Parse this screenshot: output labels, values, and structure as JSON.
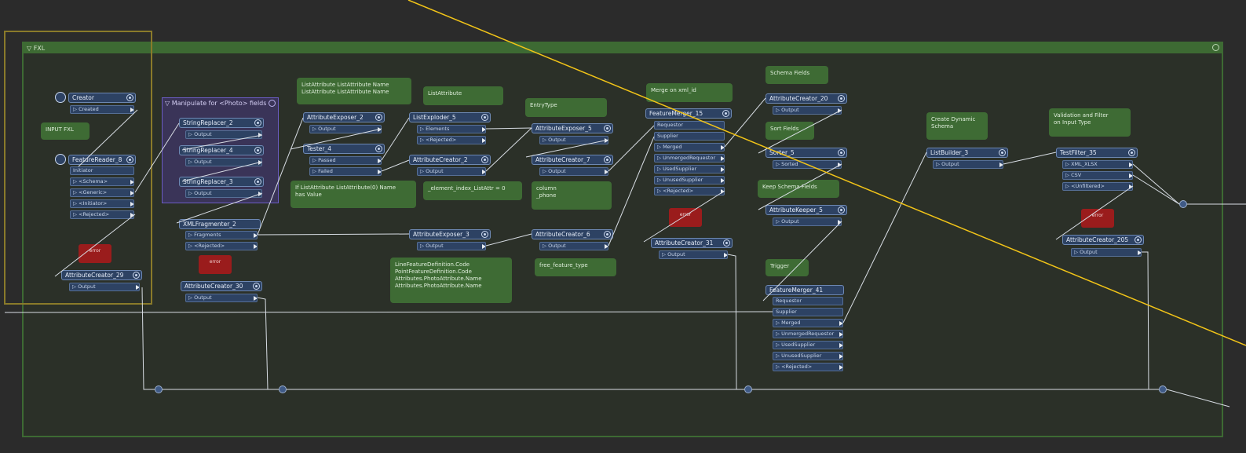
{
  "bookmarks": {
    "main": {
      "title": "▽ FXL"
    },
    "manipulate": {
      "title": "▽ Manipulate for <Photo> fields"
    }
  },
  "annotations": {
    "input_fxl": "INPUT FXL",
    "list_attributes": "ListAttribute ListAttribute Name\nListAttribute ListAttribute Name",
    "list_attr": "ListAttribute",
    "entry_type": "EntryType",
    "merge_on_xml_id": "Merge on xml_id",
    "schema_fields": "Schema Fields",
    "sort_fields": "Sort Fields",
    "keep_schema_fields": "Keep Schema Fields",
    "create_dynamic_schema": "Create Dynamic\nSchema",
    "validation_filter": "Validation and Filter\non Input Type",
    "if_list_attribute": "If ListAttribute ListAttribute(0) Name\nhas Value",
    "element_index": "_element_index_ListAttr = 0",
    "column_phone": "column\n_phone",
    "line_feature": "LineFeatureDefinition.Code\nPointFeatureDefinition.Code\nAttributes.PhotoAttribute.Name\nAttributes.PhotoAttribute.Name",
    "free_feature_type": "free_feature_type",
    "trigger": "Trigger"
  },
  "transformers": {
    "creator": {
      "name": "Creator",
      "ports": [
        "▷ Created"
      ]
    },
    "featurereader_8": {
      "name": "FeatureReader_8",
      "ports": [
        "Initiator",
        "▷ <Schema>",
        "▷ <Generic>",
        "▷ <Initiator>",
        "▷ <Rejected>"
      ]
    },
    "attributecreator_29": {
      "name": "AttributeCreator_29",
      "ports": [
        "▷ Output"
      ]
    },
    "stringreplacer_2": {
      "name": "StringReplacer_2",
      "ports": [
        "▷ Output"
      ]
    },
    "stringreplacer_4": {
      "name": "StringReplacer_4",
      "ports": [
        "▷ Output"
      ]
    },
    "stringreplacer_3": {
      "name": "StringReplacer_3",
      "ports": [
        "▷ Output"
      ]
    },
    "xmlfragmenter_2": {
      "name": "XMLFragmenter_2",
      "ports": [
        "▷ Fragments",
        "▷ <Rejected>"
      ]
    },
    "attributecreator_30": {
      "name": "AttributeCreator_30",
      "ports": [
        "▷ Output"
      ]
    },
    "attributeexposer_2": {
      "name": "AttributeExposer_2",
      "ports": [
        "▷ Output"
      ]
    },
    "tester_4": {
      "name": "Tester_4",
      "ports": [
        "▷ Passed",
        "▷ Failed"
      ]
    },
    "listexploder_5": {
      "name": "ListExploder_5",
      "ports": [
        "▷ Elements",
        "▷ <Rejected>"
      ]
    },
    "attributecreator_2": {
      "name": "AttributeCreator_2",
      "ports": [
        "▷ Output"
      ]
    },
    "attributeexposer_3": {
      "name": "AttributeExposer_3",
      "ports": [
        "▷ Output"
      ]
    },
    "attributeexposer_5": {
      "name": "AttributeExposer_5",
      "ports": [
        "▷ Output"
      ]
    },
    "attributecreator_7": {
      "name": "AttributeCreator_7",
      "ports": [
        "▷ Output"
      ]
    },
    "attributecreator_6": {
      "name": "AttributeCreator_6",
      "ports": [
        "▷ Output"
      ]
    },
    "featuremerger_15": {
      "name": "FeatureMerger_15",
      "ports": [
        "Requestor",
        "Supplier",
        "▷ Merged",
        "▷ UnmergedRequestor",
        "▷ UsedSupplier",
        "▷ UnusedSupplier",
        "▷ <Rejected>"
      ]
    },
    "attributecreator_31": {
      "name": "AttributeCreator_31",
      "ports": [
        "▷ Output"
      ]
    },
    "attributecreator_20": {
      "name": "AttributeCreator_20",
      "ports": [
        "▷ Output"
      ]
    },
    "sorter_5": {
      "name": "Sorter_5",
      "ports": [
        "▷ Sorted"
      ]
    },
    "attributekeeper_5": {
      "name": "AttributeKeeper_5",
      "ports": [
        "▷ Output"
      ]
    },
    "featuremerger_41": {
      "name": "FeatureMerger_41",
      "ports": [
        "Requestor",
        "Supplier",
        "▷ Merged",
        "▷ UnmergedRequestor",
        "▷ UsedSupplier",
        "▷ UnusedSupplier",
        "▷ <Rejected>"
      ]
    },
    "listbuilder_3": {
      "name": "ListBuilder_3",
      "ports": [
        "▷ Output"
      ]
    },
    "testfilter_35": {
      "name": "TestFilter_35",
      "ports": [
        "▷ XML_XLSX",
        "▷ CSV",
        "▷ <Unfiltered>"
      ]
    },
    "attributecreator_205": {
      "name": "AttributeCreator_205",
      "ports": [
        "▷ Output"
      ]
    }
  },
  "error_label": "error",
  "colors": {
    "background": "#2b2b2b",
    "bookmark_green": "#3d6a33",
    "bookmark_purple": "#3a3458",
    "transformer_blue": "#2d4263",
    "error_red": "#9a1c1c",
    "selection_gold": "#8a7a2a",
    "highlight_line": "#f2c418",
    "connection": "#d8dde4"
  }
}
